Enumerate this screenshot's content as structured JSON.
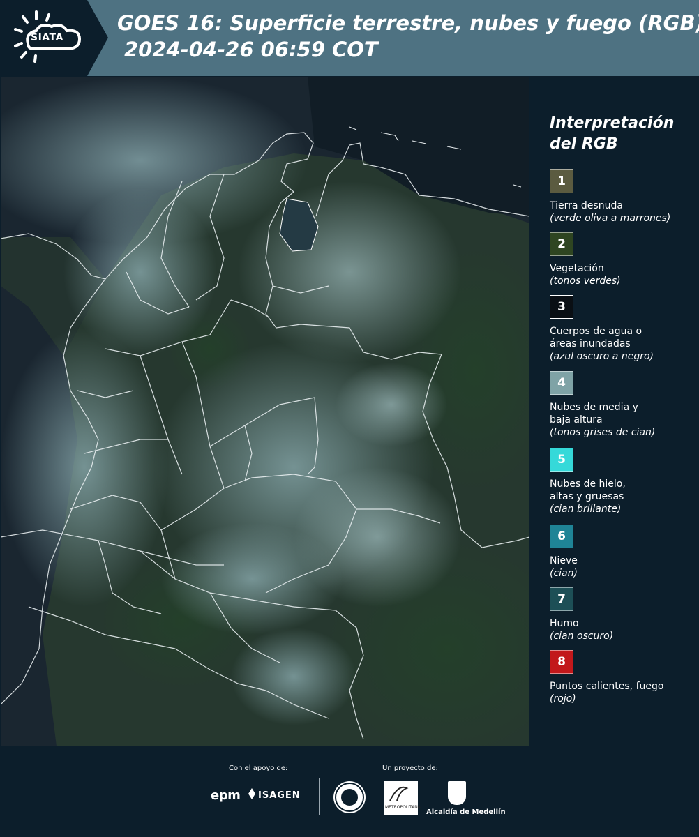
{
  "header": {
    "logo_text": "SIATA",
    "title_line1": "GOES 16: Superficie terrestre, nubes y fuego (RGB)",
    "title_line2": "2024-04-26 06:59 COT",
    "bg_color": "#4e7282"
  },
  "legend": {
    "title": "Interpretación del RGB",
    "items": [
      {
        "num": "1",
        "color": "#5b5b40",
        "label": "Tierra desnuda",
        "desc": "(verde oliva a marrones)"
      },
      {
        "num": "2",
        "color": "#2e4521",
        "label": "Vegetación",
        "desc": "(tonos verdes)"
      },
      {
        "num": "3",
        "color": "#0a0f14",
        "label": "Cuerpos de agua o\náreas inundadas",
        "desc": "(azul oscuro a negro)"
      },
      {
        "num": "4",
        "color": "#7fa3a6",
        "label": "Nubes de media y\nbaja altura",
        "desc": "(tonos grises de cian)"
      },
      {
        "num": "5",
        "color": "#35d9d9",
        "label": "Nubes de hielo,\naltas y gruesas",
        "desc": "(cian brillante)"
      },
      {
        "num": "6",
        "color": "#1f8496",
        "label": "Nieve",
        "desc": "(cian)"
      },
      {
        "num": "7",
        "color": "#1d4f56",
        "label": "Humo",
        "desc": "(cian oscuro)"
      },
      {
        "num": "8",
        "color": "#c2181b",
        "label": "Puntos calientes, fuego",
        "desc": "(rojo)"
      }
    ]
  },
  "footer": {
    "support_label": "Con el apoyo de:",
    "project_label": "Un proyecto de:",
    "sponsors": [
      "epm",
      "ISAGEN"
    ],
    "partners": [
      "Área Metropolitana Valle de Aburrá",
      "Alcaldía de Medellín"
    ],
    "epm_text": "epm",
    "isagen_text": "ISAGEN",
    "metro_text": "METROPOLITANA",
    "alcaldia_text": "Alcaldía de Medellín"
  }
}
